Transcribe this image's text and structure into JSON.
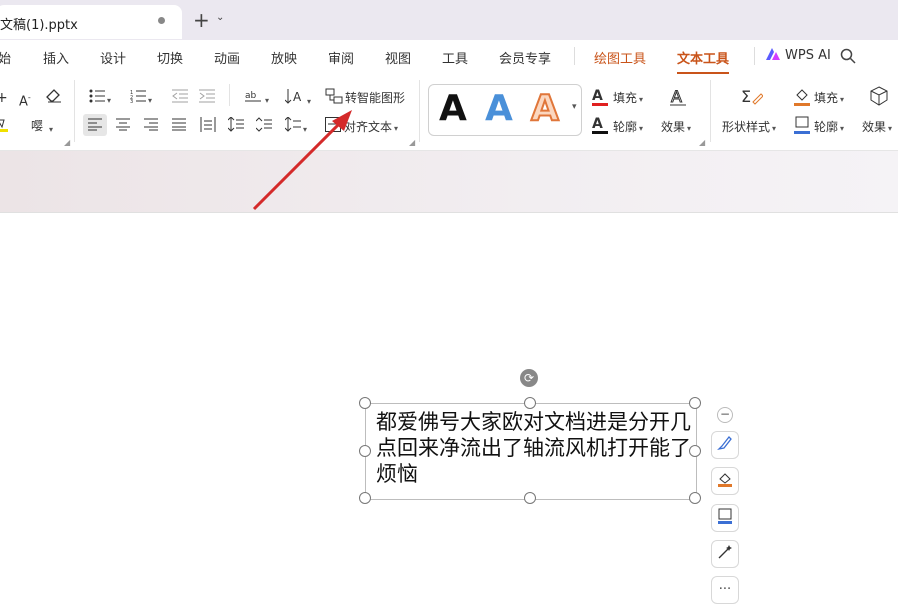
{
  "tabbar": {
    "doc_title": "文稿(1).pptx",
    "new_tab": "+",
    "menu_caret": "⌄"
  },
  "menu": {
    "items": [
      "始",
      "插入",
      "设计",
      "切换",
      "动画",
      "放映",
      "审阅",
      "视图",
      "工具",
      "会员专享",
      "绘图工具",
      "文本工具",
      "WPS AI"
    ],
    "active": "文本工具",
    "accent": "#c9541a"
  },
  "ribbon": {
    "smart_shape": "转智能图形",
    "align_text": "对齐文本",
    "fill_label": "填充",
    "outline_label": "轮廓",
    "effect_label": "效果",
    "shape_style_label": "形状样式",
    "fill2_label": "填充",
    "outline2_label": "轮廓",
    "effect2_label": "效果",
    "art_letter": "A",
    "font_size_a": "A",
    "text_fill_color": "#e02020",
    "text_outline_color": "#111111",
    "shape_fill_color": "#e0782a",
    "shape_outline_color": "#3b6fd4"
  },
  "textbox": {
    "content": "都爱佛号大家欧对文档进是分开几点回来净流出了轴流风机打开能了烦恼"
  },
  "side_toolbar": {
    "more": "···"
  }
}
